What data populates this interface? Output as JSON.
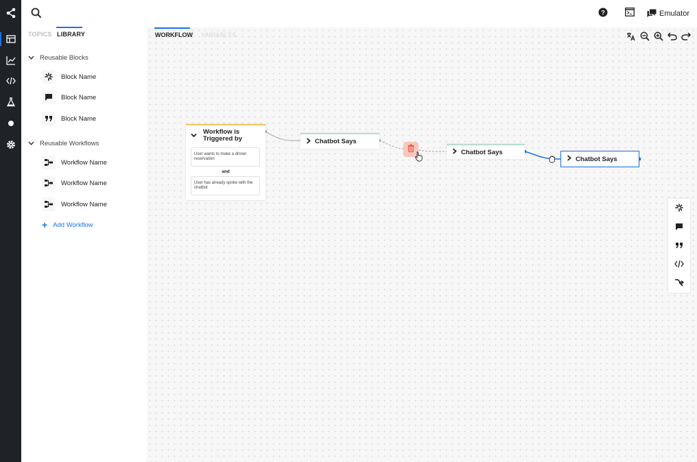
{
  "rail": {
    "items": [
      "share-icon",
      "table-icon",
      "chart-icon",
      "code-icon",
      "flask-icon",
      "circle-icon",
      "gear-icon"
    ]
  },
  "topbar": {
    "search_icon": "search-icon",
    "help_icon": "help-icon",
    "terminal_icon": "terminal-icon",
    "emulator_label": "Emulator"
  },
  "library": {
    "tabs": [
      {
        "label": "TOPICS",
        "active": false
      },
      {
        "label": "LIBRARY",
        "active": true
      }
    ],
    "reusable_blocks": {
      "label": "Reusable Blocks",
      "items": [
        {
          "label": "Block Name",
          "icon": "sparkle-icon"
        },
        {
          "label": "Block Name",
          "icon": "chat-icon"
        },
        {
          "label": "Block Name",
          "icon": "quote-icon"
        }
      ]
    },
    "reusable_workflows": {
      "label": "Reusable Workflows",
      "items": [
        {
          "label": "Workflow Name",
          "icon": "workflow-icon"
        },
        {
          "label": "Workflow Name",
          "icon": "workflow-icon"
        },
        {
          "label": "Workflow Name",
          "icon": "workflow-icon"
        }
      ]
    },
    "add_workflow_label": "Add Workflow"
  },
  "canvas": {
    "tabs": [
      {
        "label": "WORKFLOW",
        "active": true
      },
      {
        "label": "VARIABLES",
        "active": false
      }
    ],
    "tools": [
      "translate-icon",
      "zoom-out-icon",
      "zoom-in-icon",
      "undo-icon",
      "redo-icon"
    ],
    "trigger": {
      "title": "Workflow is Triggered by",
      "conditions": [
        "User wants to make a dinner reservation",
        "User has already spoke with the chatbot"
      ],
      "joiner": "and"
    },
    "nodes": [
      {
        "label": "Chatbot Says"
      },
      {
        "label": "Chatbot Says"
      },
      {
        "label": "Chatbot Says"
      }
    ],
    "palette": [
      "sparkle-icon",
      "chat-icon",
      "quote-icon",
      "code-icon",
      "branch-icon"
    ]
  },
  "colors": {
    "accent": "#1a73e8",
    "rail": "#1f2227",
    "trigger_border": "#f4c95d",
    "node_border": "#b7dfcd",
    "delete_bg": "#f9c7bd",
    "delete_icon": "#e8594a"
  }
}
